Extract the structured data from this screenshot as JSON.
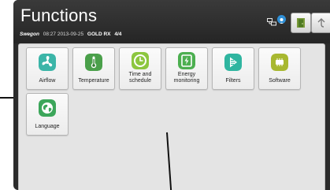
{
  "header": {
    "title": "Functions",
    "brand": "Swegon",
    "time": "08:27",
    "date": "2013-09-25",
    "model": "GOLD RX",
    "unit": "4/4"
  },
  "status_icons": [
    "network-icon",
    "user-icon"
  ],
  "header_buttons": [
    {
      "name": "door-exit-icon"
    },
    {
      "name": "back-arrow-icon"
    }
  ],
  "tiles": [
    {
      "label": "Airflow",
      "icon": "fan-icon",
      "color": "#3bb5a8"
    },
    {
      "label": "Temperature",
      "icon": "thermometer-icon",
      "color": "#4aa04a"
    },
    {
      "label": "Time and schedule",
      "icon": "clock-icon",
      "color": "#8cc63f"
    },
    {
      "label": "Energy monitoring",
      "icon": "energy-meter-icon",
      "color": "#4caf50"
    },
    {
      "label": "Filters",
      "icon": "filter-icon",
      "color": "#2fb5a0"
    },
    {
      "label": "Software",
      "icon": "chip-icon",
      "color": "#a8b830"
    },
    {
      "label": "Language",
      "icon": "globe-icon",
      "color": "#3ca65a"
    }
  ]
}
